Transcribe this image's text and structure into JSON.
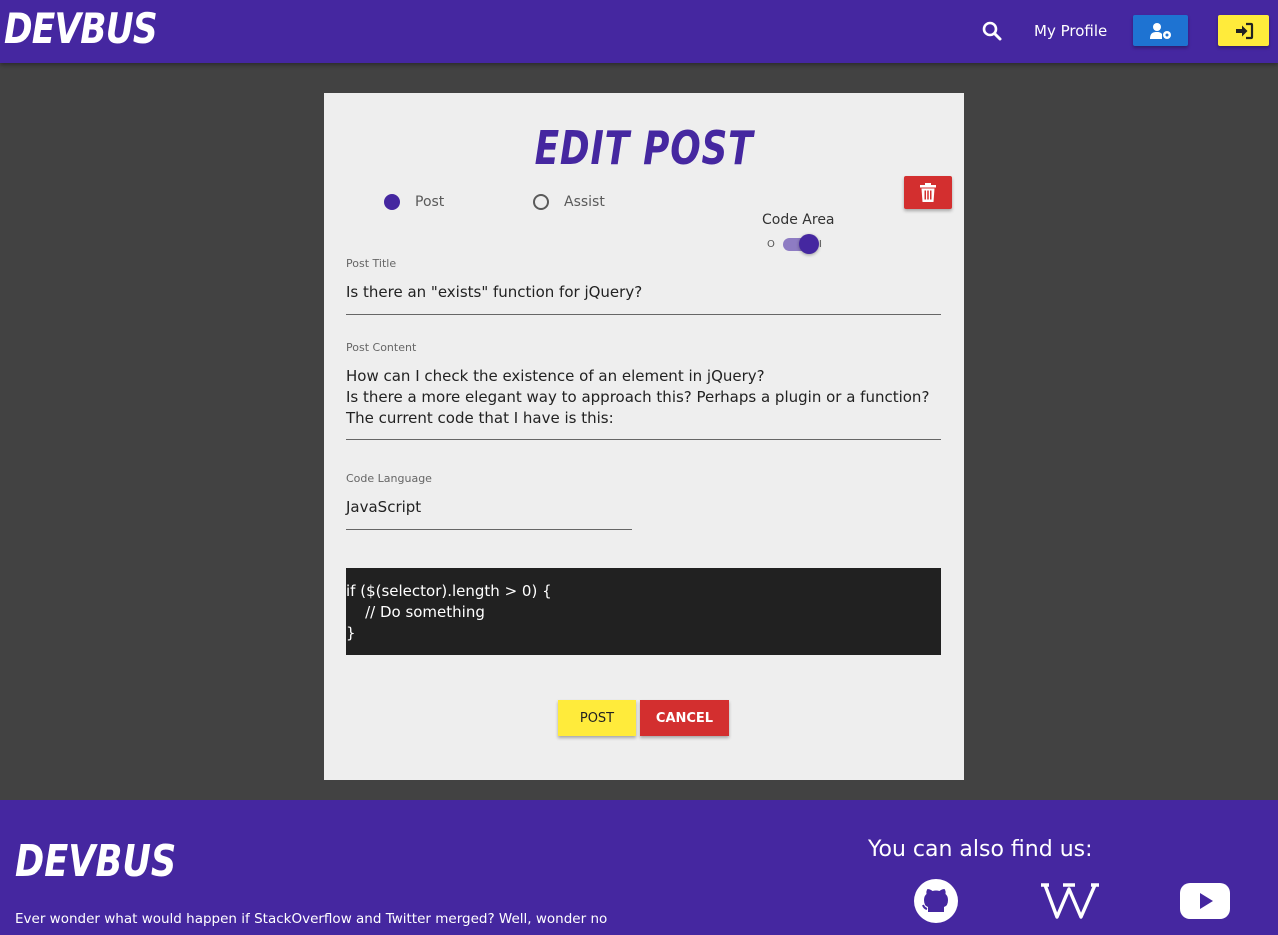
{
  "nav": {
    "brand": "DEVBUS",
    "profile_label": "My Profile",
    "icons": {
      "search": "search-icon",
      "settings": "user-cog-icon",
      "login": "sign-in-icon"
    }
  },
  "form": {
    "title": "EDIT POST",
    "type_options": [
      {
        "label": "Post",
        "checked": true
      },
      {
        "label": "Assist",
        "checked": false
      }
    ],
    "code_area": {
      "label": "Code Area",
      "off_label": "O",
      "on_label": "I",
      "enabled": true
    },
    "post_title": {
      "label": "Post Title",
      "value": "Is there an \"exists\" function for jQuery?"
    },
    "post_content": {
      "label": "Post Content",
      "lines": [
        "How can I check the existence of an element in jQuery?",
        "Is there a more elegant way to approach this? Perhaps a plugin or a function?",
        "The current code that I have is this:"
      ]
    },
    "code_language": {
      "label": "Code Language",
      "value": "JavaScript"
    },
    "code": "if ($(selector).length > 0) {\n    // Do something\n}",
    "post_button": "POST",
    "cancel_button": "CANCEL"
  },
  "footer": {
    "brand": "DEVBUS",
    "tagline": "Ever wonder what would happen if StackOverflow and Twitter merged? Well, wonder no",
    "find_us": "You can also find us:",
    "socials": [
      "github-icon",
      "wikipedia-icon",
      "youtube-icon"
    ]
  },
  "colors": {
    "primary": "#4527a0",
    "background": "#424242",
    "card": "#eeeeee",
    "yellow": "#ffeb3b",
    "red": "#d32f2f",
    "blue": "#1e73d2",
    "code_bg": "#212121"
  }
}
